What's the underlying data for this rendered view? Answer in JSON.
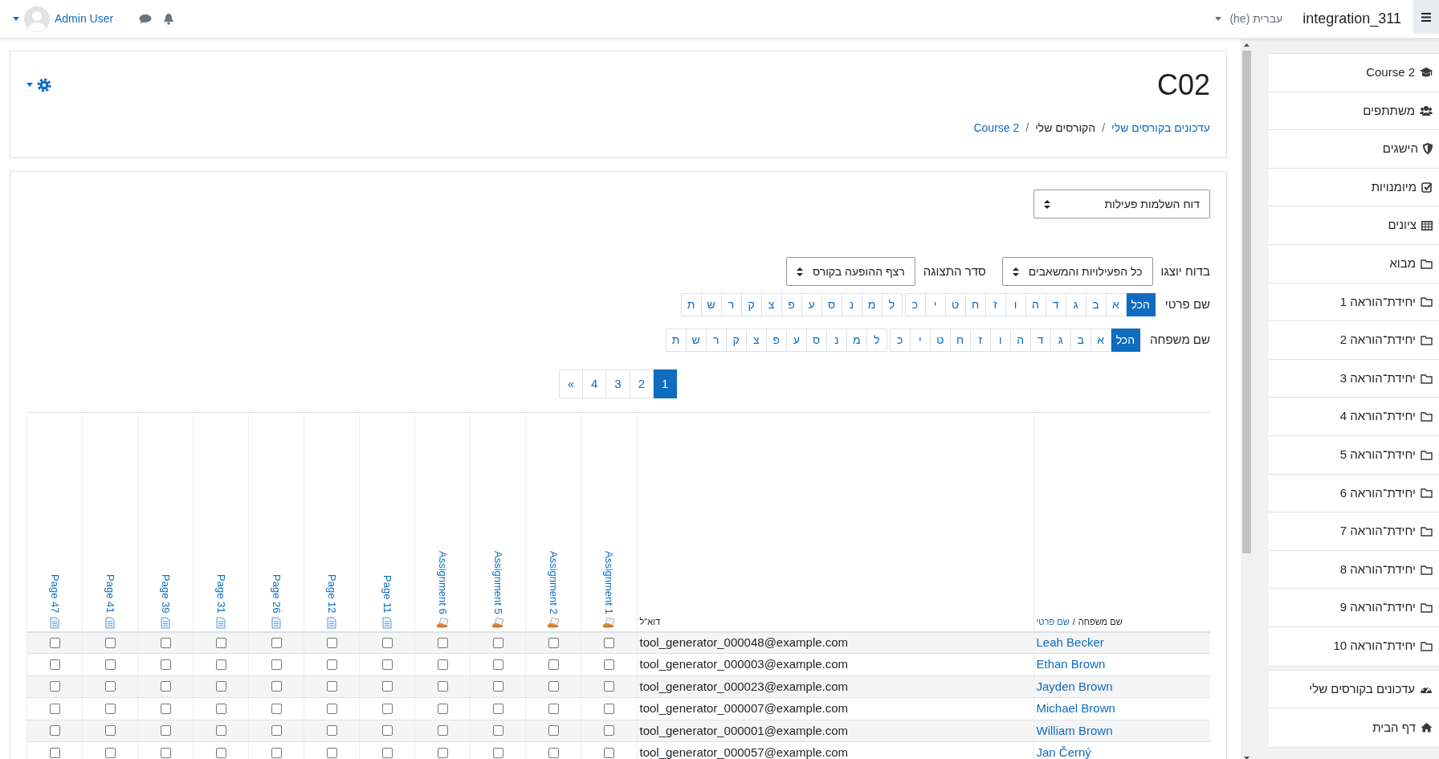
{
  "navbar": {
    "brand": "integration_311",
    "language": "עברית (he)",
    "user": "Admin User"
  },
  "header": {
    "title": "C02",
    "separator": "/",
    "breadcrumb": [
      {
        "label": "עדכונים בקורסים שלי",
        "link": true
      },
      {
        "label": "הקורסים שלי",
        "link": false
      },
      {
        "label": "Course 2",
        "link": true
      }
    ]
  },
  "report_select": "דוח השלמות פעילות",
  "filters": [
    {
      "label": "בדוח יוצגו",
      "value": "כל הפעילויות והמשאבים"
    },
    {
      "label": "סדר התצוגה",
      "value": "רצף ההופעה בקורס"
    }
  ],
  "initials_bars": [
    {
      "label": "שם פרטי",
      "groups": [
        [
          {
            "label": "הכל",
            "selected": true
          },
          {
            "label": "א",
            "selected": false
          },
          {
            "label": "ב",
            "selected": false
          },
          {
            "label": "ג",
            "selected": false
          },
          {
            "label": "ד",
            "selected": false
          },
          {
            "label": "ה",
            "selected": false
          },
          {
            "label": "ו",
            "selected": false
          },
          {
            "label": "ז",
            "selected": false
          },
          {
            "label": "ח",
            "selected": false
          },
          {
            "label": "ט",
            "selected": false
          },
          {
            "label": "י",
            "selected": false
          },
          {
            "label": "כ",
            "selected": false
          }
        ],
        [
          {
            "label": "ל",
            "selected": false
          },
          {
            "label": "מ",
            "selected": false
          },
          {
            "label": "נ",
            "selected": false
          },
          {
            "label": "ס",
            "selected": false
          },
          {
            "label": "ע",
            "selected": false
          },
          {
            "label": "פ",
            "selected": false
          },
          {
            "label": "צ",
            "selected": false
          },
          {
            "label": "ק",
            "selected": false
          },
          {
            "label": "ר",
            "selected": false
          },
          {
            "label": "ש",
            "selected": false
          },
          {
            "label": "ת",
            "selected": false
          }
        ]
      ]
    },
    {
      "label": "שם משפחה",
      "groups": [
        [
          {
            "label": "הכל",
            "selected": true
          },
          {
            "label": "א",
            "selected": false
          },
          {
            "label": "ב",
            "selected": false
          },
          {
            "label": "ג",
            "selected": false
          },
          {
            "label": "ד",
            "selected": false
          },
          {
            "label": "ה",
            "selected": false
          },
          {
            "label": "ו",
            "selected": false
          },
          {
            "label": "ז",
            "selected": false
          },
          {
            "label": "ח",
            "selected": false
          },
          {
            "label": "ט",
            "selected": false
          },
          {
            "label": "י",
            "selected": false
          },
          {
            "label": "כ",
            "selected": false
          }
        ],
        [
          {
            "label": "ל",
            "selected": false
          },
          {
            "label": "מ",
            "selected": false
          },
          {
            "label": "נ",
            "selected": false
          },
          {
            "label": "ס",
            "selected": false
          },
          {
            "label": "ע",
            "selected": false
          },
          {
            "label": "פ",
            "selected": false
          },
          {
            "label": "צ",
            "selected": false
          },
          {
            "label": "ק",
            "selected": false
          },
          {
            "label": "ר",
            "selected": false
          },
          {
            "label": "ש",
            "selected": false
          },
          {
            "label": "ת",
            "selected": false
          }
        ]
      ]
    }
  ],
  "pagination": [
    {
      "label": "1",
      "selected": true
    },
    {
      "label": "2",
      "selected": false
    },
    {
      "label": "3",
      "selected": false
    },
    {
      "label": "4",
      "selected": false
    },
    {
      "label": "»",
      "selected": false
    }
  ],
  "table": {
    "name_header": {
      "last": "שם משפחה",
      "separator": "/",
      "first": "שם פרטי"
    },
    "email_header": "דוא\"ל",
    "activities": [
      {
        "name": "Assignment 1",
        "kind": "assignment"
      },
      {
        "name": "Assignment 2",
        "kind": "assignment"
      },
      {
        "name": "Assignment 5",
        "kind": "assignment"
      },
      {
        "name": "Assignment 6",
        "kind": "assignment"
      },
      {
        "name": "Page 11",
        "kind": "page"
      },
      {
        "name": "Page 12",
        "kind": "page"
      },
      {
        "name": "Page 26",
        "kind": "page"
      },
      {
        "name": "Page 31",
        "kind": "page"
      },
      {
        "name": "Page 39",
        "kind": "page"
      },
      {
        "name": "Page 41",
        "kind": "page"
      },
      {
        "name": "Page 47",
        "kind": "page"
      }
    ],
    "rows": [
      {
        "name": "Leah Becker",
        "email": "tool_generator_000048@example.com",
        "checks": [
          false,
          false,
          false,
          false,
          false,
          false,
          false,
          false,
          false,
          false,
          false
        ]
      },
      {
        "name": "Ethan Brown",
        "email": "tool_generator_000003@example.com",
        "checks": [
          false,
          false,
          false,
          false,
          false,
          false,
          false,
          false,
          false,
          false,
          false
        ]
      },
      {
        "name": "Jayden Brown",
        "email": "tool_generator_000023@example.com",
        "checks": [
          false,
          false,
          false,
          false,
          false,
          false,
          false,
          false,
          false,
          false,
          false
        ]
      },
      {
        "name": "Michael Brown",
        "email": "tool_generator_000007@example.com",
        "checks": [
          false,
          false,
          false,
          false,
          false,
          false,
          false,
          false,
          false,
          false,
          false
        ]
      },
      {
        "name": "William Brown",
        "email": "tool_generator_000001@example.com",
        "checks": [
          false,
          false,
          false,
          false,
          false,
          false,
          false,
          false,
          false,
          false,
          false
        ]
      },
      {
        "name": "Jan Černý",
        "email": "tool_generator_000057@example.com",
        "checks": [
          false,
          false,
          false,
          false,
          false,
          false,
          false,
          false,
          false,
          false,
          false
        ]
      }
    ]
  },
  "sidebar": {
    "groups": [
      {
        "items": [
          {
            "label": "Course 2",
            "kind": "course"
          },
          {
            "label": "משתתפים",
            "kind": "participants"
          },
          {
            "label": "הישגים",
            "kind": "badges"
          },
          {
            "label": "מיומנויות",
            "kind": "competencies"
          },
          {
            "label": "ציונים",
            "kind": "grades"
          },
          {
            "label": "מבוא",
            "kind": "section"
          },
          {
            "label": "יחידת־הוראה 1",
            "kind": "section"
          },
          {
            "label": "יחידת־הוראה 2",
            "kind": "section"
          },
          {
            "label": "יחידת־הוראה 3",
            "kind": "section"
          },
          {
            "label": "יחידת־הוראה 4",
            "kind": "section"
          },
          {
            "label": "יחידת־הוראה 5",
            "kind": "section"
          },
          {
            "label": "יחידת־הוראה 6",
            "kind": "section"
          },
          {
            "label": "יחידת־הוראה 7",
            "kind": "section"
          },
          {
            "label": "יחידת־הוראה 8",
            "kind": "section"
          },
          {
            "label": "יחידת־הוראה 9",
            "kind": "section"
          },
          {
            "label": "יחידת־הוראה 10",
            "kind": "section"
          }
        ]
      },
      {
        "items": [
          {
            "label": "עדכונים בקורסים שלי",
            "kind": "dashboard"
          },
          {
            "label": "דף הבית",
            "kind": "home"
          }
        ]
      }
    ]
  }
}
